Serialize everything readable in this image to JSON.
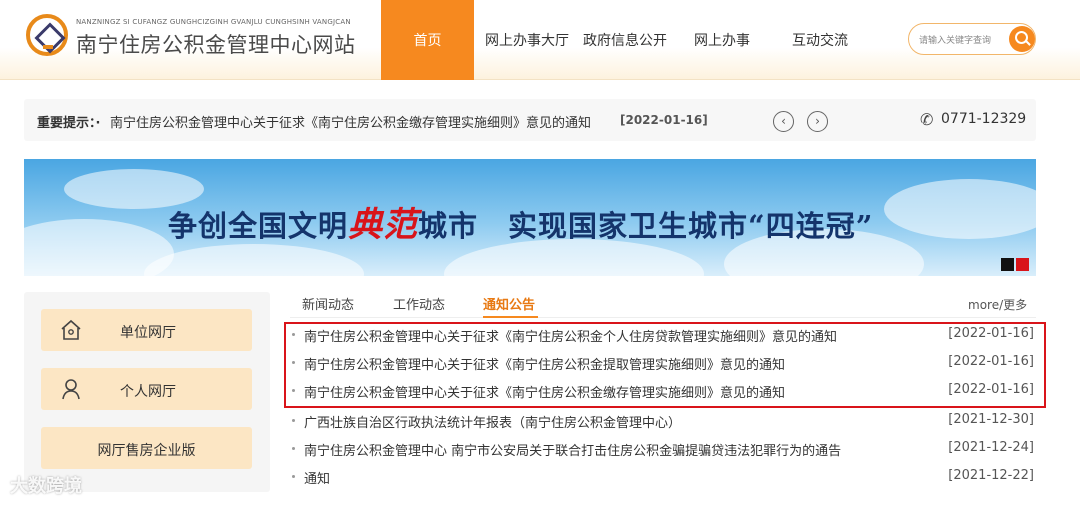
{
  "site": {
    "pinyin": "NANZNINGZ SI CUFANGZ GUNGHCIZGINH GVANJLU CUNGHSINH VANGJCAN",
    "title": "南宁住房公积金管理中心网站"
  },
  "nav": {
    "active": "首页",
    "items": [
      "网上办事大厅",
      "政府信息公开",
      "网上办事",
      "互动交流"
    ]
  },
  "search": {
    "placeholder": "请输入关键字查询"
  },
  "notice": {
    "label": "重要提示：·",
    "text": "南宁住房公积金管理中心关于征求《南宁住房公积金缴存管理实施细则》意见的通知",
    "date": "[2022-01-16]",
    "phone": "0771-12329"
  },
  "banner": {
    "part1": "争创全国文明",
    "highlight": "典范",
    "part2": "城市　实现国家卫生城市“四连冠”",
    "dot_colors": [
      "#111111",
      "#d9141a"
    ]
  },
  "sidebar": {
    "items": [
      "单位网厅",
      "个人网厅",
      "网厅售房企业版"
    ]
  },
  "news": {
    "tabs": [
      "新闻动态",
      "工作动态",
      "通知公告"
    ],
    "more": "more/更多",
    "rows": [
      {
        "title": "南宁住房公积金管理中心关于征求《南宁住房公积金个人住房贷款管理实施细则》意见的通知",
        "date": "[2022-01-16]"
      },
      {
        "title": "南宁住房公积金管理中心关于征求《南宁住房公积金提取管理实施细则》意见的通知",
        "date": "[2022-01-16]"
      },
      {
        "title": "南宁住房公积金管理中心关于征求《南宁住房公积金缴存管理实施细则》意见的通知",
        "date": "[2022-01-16]"
      },
      {
        "title": "广西壮族自治区行政执法统计年报表（南宁住房公积金管理中心）",
        "date": "[2021-12-30]"
      },
      {
        "title": "南宁住房公积金管理中心 南宁市公安局关于联合打击住房公积金骗提骗贷违法犯罪行为的通告",
        "date": "[2021-12-24]"
      },
      {
        "title": "通知",
        "date": "[2021-12-22]"
      }
    ]
  },
  "watermark": "大数跨境",
  "colors": {
    "accent": "#f6891f",
    "highlight_box": "#d9141a",
    "banner_text": "#14346b"
  }
}
